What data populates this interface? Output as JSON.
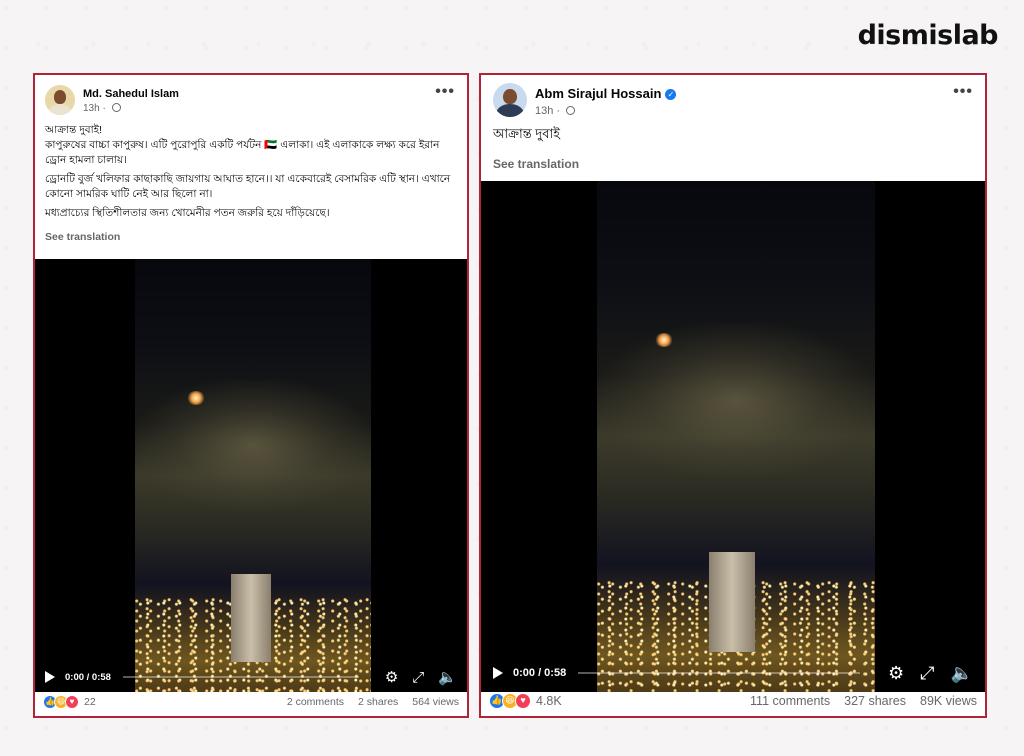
{
  "brand": "dismislab",
  "posts": [
    {
      "author": "Md. Sahedul Islam",
      "time": "13h",
      "paragraphs": [
        "আক্রান্ত দুবাই!\nকাপুরুষের বাচ্চা কাপুরুষ। এটি পুরোপুরি একটি পর্যটন 🇦🇪 এলাকা। এই এলাকাকে লক্ষ্য করে ইরান ড্রোন হামলা চালায়।",
        "ড্রোনটি বুর্জ খলিফার কাছাকাছি জায়গায় আঘাত হানে।। যা একেবারেই বেসামরিক এটি স্থান। এখানে কোনো সামরিক ঘাটি নেই আর ছিলো না।",
        "মধ্যপ্রাচ্যের স্থিতিশীলতার জন্য খোমেনীর পতন জরুরি হয়ে দাঁড়িয়েছে।"
      ],
      "see_translation": "See translation",
      "video_time": "0:00 / 0:58",
      "reactions_count": "22",
      "comments": "2 comments",
      "shares": "2 shares",
      "views": "564 views"
    },
    {
      "author": "Abm Sirajul Hossain",
      "verified": true,
      "time": "13h",
      "paragraphs": [
        "আক্রান্ত দুবাই"
      ],
      "see_translation": "See translation",
      "video_time": "0:00 / 0:58",
      "reactions_count": "4.8K",
      "comments": "111 comments",
      "shares": "327 shares",
      "views": "89K views"
    }
  ],
  "icons": {
    "more": "more-options-icon",
    "globe": "globe-icon",
    "play": "play-icon",
    "settings": "gear-icon",
    "fullscreen": "fullscreen-icon",
    "volume": "volume-icon",
    "reactions": [
      "like-icon",
      "haha-icon",
      "love-icon"
    ]
  },
  "colors": {
    "border": "#b0243a",
    "like": "#1877f2",
    "haha": "#f7b125",
    "love": "#f33e58",
    "muted_text": "#65676b"
  }
}
